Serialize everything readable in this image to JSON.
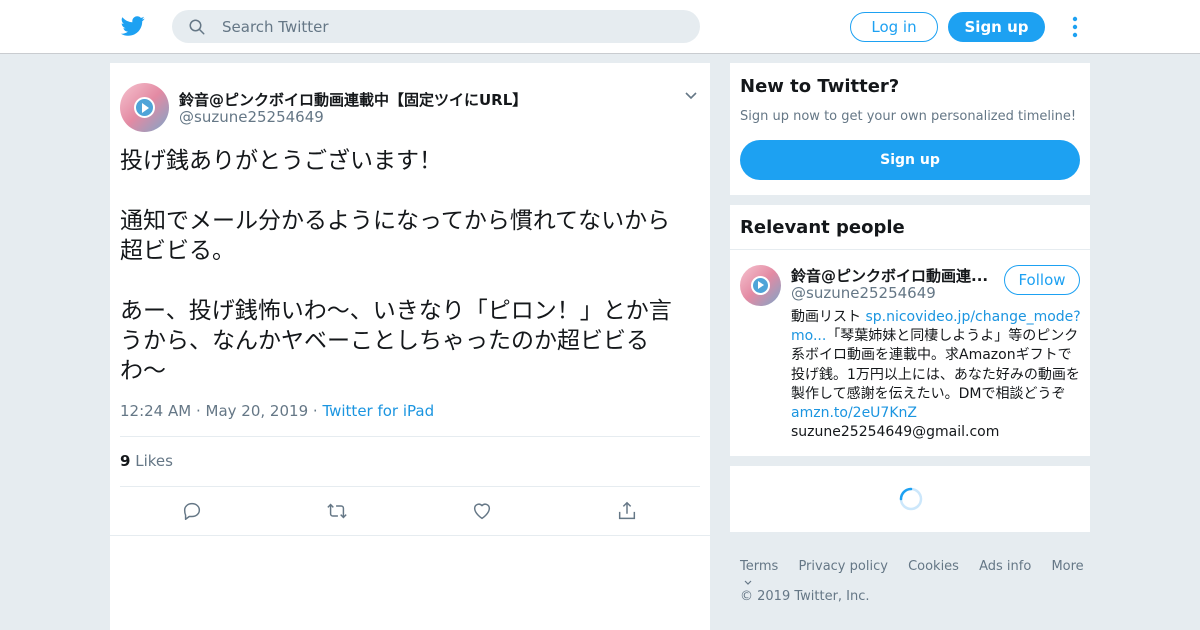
{
  "header": {
    "search_placeholder": "Search Twitter",
    "login_label": "Log in",
    "signup_label": "Sign up"
  },
  "tweet": {
    "author_name": "鈴音@ピンクボイロ動画連載中【固定ツイにURL】",
    "author_handle": "@suzune25254649",
    "text": "投げ銭ありがとうございます！\n\n通知でメール分かるようになってから慣れてないから\n超ビビる。\n\nあー、投げ銭怖いわ〜、いきなり「ピロン！」とか言\nうから、なんかヤベーことしちゃったのか超ビビる\nわ〜",
    "time": "12:24 AM",
    "date": "May 20, 2019",
    "source": "Twitter for iPad",
    "likes_count": "9",
    "likes_label": "Likes"
  },
  "sidebar": {
    "new_to_twitter": {
      "title": "New to Twitter?",
      "subtitle": "Sign up now to get your own personalized timeline!",
      "button": "Sign up"
    },
    "relevant_people": {
      "title": "Relevant people",
      "person": {
        "name": "鈴音@ピンクボイロ動画連...",
        "handle": "@suzune25254649",
        "follow_label": "Follow",
        "bio_prefix": "動画リスト ",
        "bio_link1": "sp.nicovideo.jp/change_mode?mo...",
        "bio_middle": "「琴葉姉妹と同棲しようよ」等のピンク系ボイロ動画を連載中。求Amazonギフトで投げ銭。1万円以上には、あなた好みの動画を製作して感謝を伝えたい。DMで相談どうぞ ",
        "bio_link2": "amzn.to/2eU7KnZ",
        "bio_suffix": "suzune25254649@gmail.com"
      }
    }
  },
  "footer": {
    "terms": "Terms",
    "privacy": "Privacy policy",
    "cookies": "Cookies",
    "ads": "Ads info",
    "more": "More",
    "copyright": "© 2019 Twitter, Inc."
  },
  "colors": {
    "brand": "#1da1f2",
    "link": "#1b95e0",
    "secondary_text": "#657786",
    "background": "#e6ecf0"
  },
  "icons": [
    "twitter-bird-icon",
    "search-icon",
    "more-vertical-icon",
    "chevron-down-icon",
    "reply-icon",
    "retweet-icon",
    "like-icon",
    "share-icon",
    "loading-spinner-icon"
  ]
}
